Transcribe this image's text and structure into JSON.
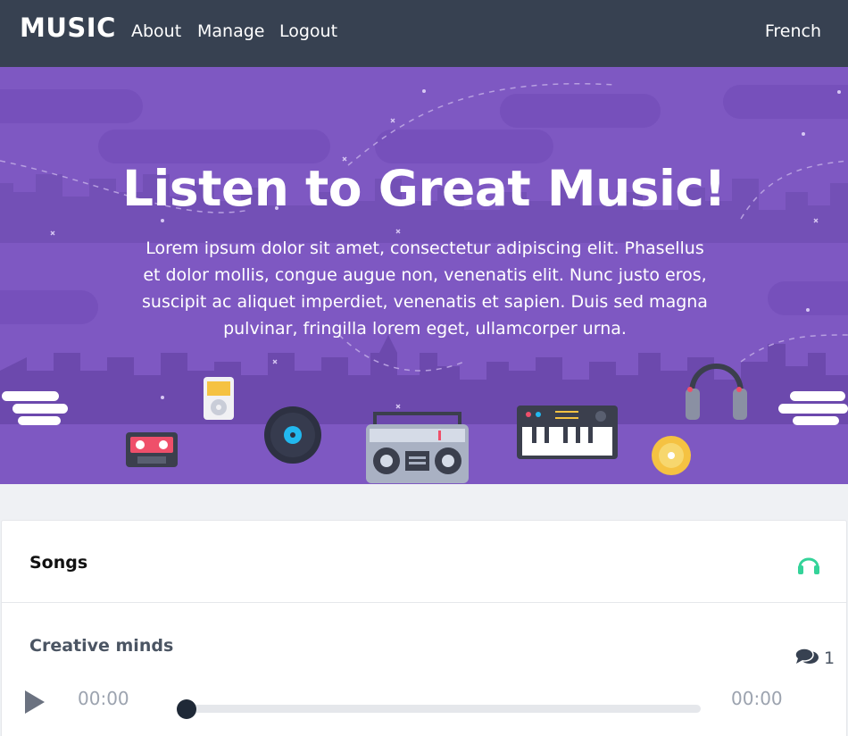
{
  "nav": {
    "brand": "MUSIC",
    "links": [
      "About",
      "Manage",
      "Logout"
    ],
    "language": "French"
  },
  "hero": {
    "title": "Listen to Great Music!",
    "text": "Lorem ipsum dolor sit amet, consectetur adipiscing elit. Phasellus et dolor mollis, congue augue non, venenatis elit. Nunc justo eros, suscipit ac aliquet imperdiet, venenatis et sapien. Duis sed magna pulvinar, fringilla lorem eget, ullamcorper urna."
  },
  "songs": {
    "title": "Songs",
    "header_icon": "headphones-icon",
    "items": [
      {
        "title": "Creative minds",
        "comment_count": "1"
      }
    ]
  },
  "player": {
    "current_time": "00:00",
    "duration": "00:00",
    "progress": 0,
    "play_icon": "play-icon"
  },
  "colors": {
    "navbar": "#374151",
    "hero": "#7e58c2",
    "accent_green": "#34d399"
  }
}
